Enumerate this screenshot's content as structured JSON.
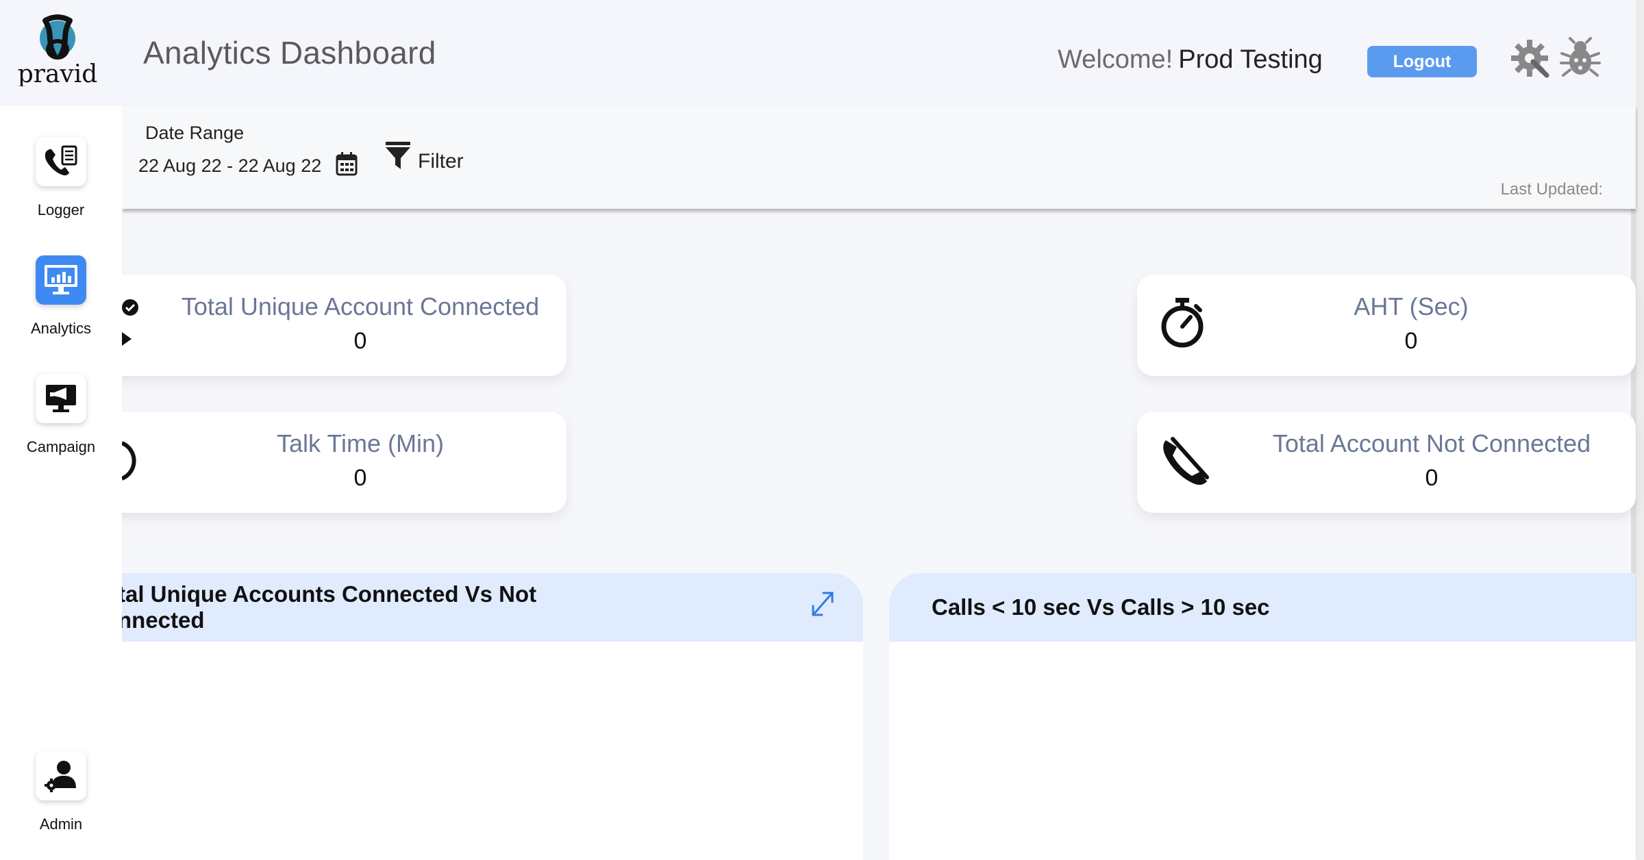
{
  "header": {
    "logo_text": "pravid",
    "title": "Analytics Dashboard",
    "welcome_prefix": "Welcome!",
    "user_name": "Prod Testing",
    "logout_label": "Logout"
  },
  "sidebar": {
    "items": [
      {
        "label": "Logger",
        "icon": "phone-log-icon",
        "active": false
      },
      {
        "label": "Analytics",
        "icon": "monitor-chart-icon",
        "active": true
      },
      {
        "label": "Campaign",
        "icon": "megaphone-monitor-icon",
        "active": false
      },
      {
        "label": "Admin",
        "icon": "user-gear-icon",
        "active": false
      }
    ]
  },
  "filters": {
    "date_range_label": "Date Range",
    "date_range_value": "22 Aug 22 - 22 Aug 22",
    "filter_label": "Filter",
    "last_updated_label": "Last Updated:"
  },
  "stats": {
    "total_unique_connected": {
      "title": "Total Unique Account Connected",
      "value": "0"
    },
    "talk_time": {
      "title": "Talk Time (Min)",
      "value": "0"
    },
    "aht": {
      "title": "AHT (Sec)",
      "value": "0"
    },
    "not_connected": {
      "title": "Total Account Not Connected",
      "value": "0"
    }
  },
  "panels": {
    "connected_vs_not": {
      "title_line1": "tal Unique Accounts Connected Vs Not",
      "title_line2": "nnected"
    },
    "calls_duration": {
      "title": "Calls < 10 sec Vs Calls > 10 sec"
    }
  },
  "colors": {
    "accent": "#3f8af2",
    "logout": "#5b9bef",
    "card_title": "#6a7796",
    "panel_header": "#e0ebfd"
  }
}
